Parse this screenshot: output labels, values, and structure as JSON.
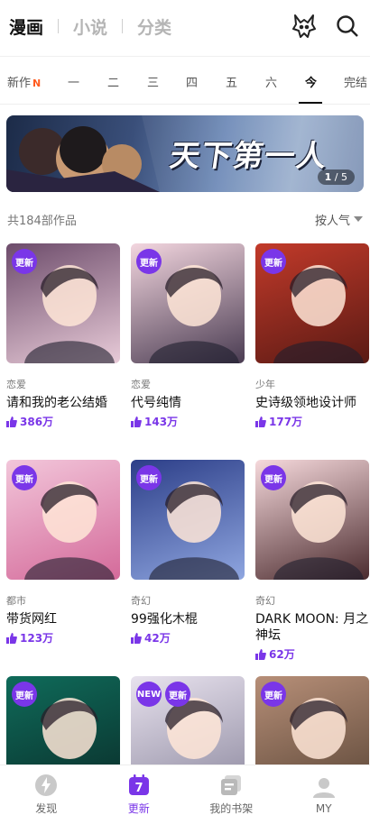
{
  "header": {
    "tabs": [
      {
        "label": "漫画",
        "active": true
      },
      {
        "label": "小说",
        "active": false
      },
      {
        "label": "分类",
        "active": false
      }
    ],
    "icons": [
      "badge-fox-icon",
      "search-icon"
    ]
  },
  "day_tabs": {
    "items": [
      "新作",
      "一",
      "二",
      "三",
      "四",
      "五",
      "六",
      "今",
      "完结"
    ],
    "new_badge": "N",
    "active": "今"
  },
  "banner": {
    "title": "天下第一人",
    "pager_current": "1",
    "pager_total": "/ 5"
  },
  "list": {
    "count": "共184部作品",
    "sort_label": "按人气"
  },
  "cards": [
    {
      "genre": "恋爱",
      "title": "请和我的老公结婚",
      "likes": "386万",
      "badges": [
        "更新"
      ],
      "c1": "#6d4c6b",
      "c2": "#e8cbd8"
    },
    {
      "genre": "恋爱",
      "title": "代号纯情",
      "likes": "143万",
      "badges": [
        "更新"
      ],
      "c1": "#f3d6df",
      "c2": "#4a3c52"
    },
    {
      "genre": "少年",
      "title": "史诗级领地设计师",
      "likes": "177万",
      "badges": [
        "更新"
      ],
      "c1": "#c23a2a",
      "c2": "#5a1a14"
    },
    {
      "genre": "都市",
      "title": "带货网红",
      "likes": "123万",
      "badges": [
        "更新"
      ],
      "c1": "#f2c6da",
      "c2": "#d46a9a"
    },
    {
      "genre": "奇幻",
      "title": "99强化木棍",
      "likes": "42万",
      "badges": [
        "更新"
      ],
      "c1": "#2c3e88",
      "c2": "#8fa6e0"
    },
    {
      "genre": "奇幻",
      "title": "DARK MOON: 月之神坛",
      "likes": "62万",
      "badges": [
        "更新"
      ],
      "c1": "#f6d9dc",
      "c2": "#4b2b2e"
    },
    {
      "genre": "",
      "title": "",
      "likes": "",
      "badges": [
        "更新"
      ],
      "c1": "#0f6b5a",
      "c2": "#0a2e2a"
    },
    {
      "genre": "",
      "title": "",
      "likes": "",
      "badges": [
        "NEW",
        "更新"
      ],
      "c1": "#e8e2ee",
      "c2": "#8e8aa0"
    },
    {
      "genre": "",
      "title": "",
      "likes": "",
      "badges": [
        "更新"
      ],
      "c1": "#b78f78",
      "c2": "#5c4738"
    }
  ],
  "bottom_nav": [
    {
      "label": "发现",
      "icon": "discover-icon",
      "active": false
    },
    {
      "label": "更新",
      "icon": "calendar-icon",
      "active": true,
      "icon_text": "7"
    },
    {
      "label": "我的书架",
      "icon": "bookshelf-icon",
      "active": false
    },
    {
      "label": "MY",
      "icon": "profile-icon",
      "active": false
    }
  ],
  "colors": {
    "accent": "#7a36e8",
    "new_badge": "#ff5a1e"
  }
}
